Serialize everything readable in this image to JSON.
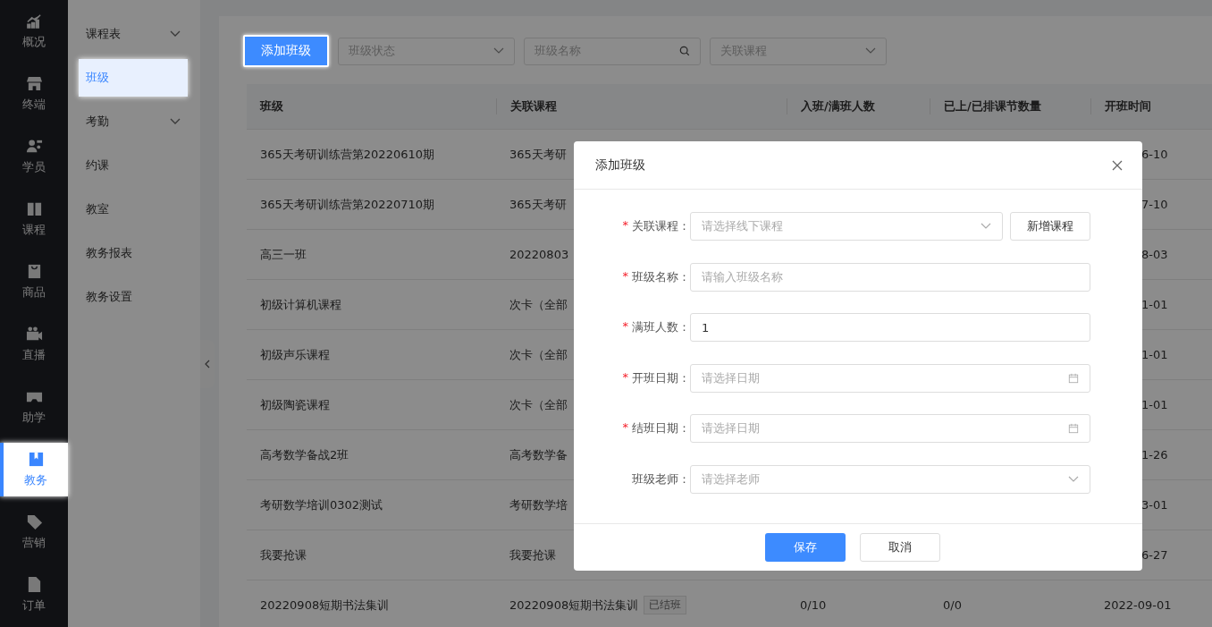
{
  "nav": [
    {
      "label": "概况",
      "selected": false
    },
    {
      "label": "终端",
      "selected": false
    },
    {
      "label": "学员",
      "selected": false
    },
    {
      "label": "课程",
      "selected": false
    },
    {
      "label": "商品",
      "selected": false
    },
    {
      "label": "直播",
      "selected": false
    },
    {
      "label": "助学",
      "selected": false
    },
    {
      "label": "教务",
      "selected": true
    },
    {
      "label": "营销",
      "selected": false
    },
    {
      "label": "订单",
      "selected": false
    }
  ],
  "submenu": [
    {
      "label": "课程表",
      "expandable": true,
      "selected": false
    },
    {
      "label": "班级",
      "expandable": false,
      "selected": true
    },
    {
      "label": "考勤",
      "expandable": true,
      "selected": false
    },
    {
      "label": "约课",
      "expandable": false,
      "selected": false
    },
    {
      "label": "教室",
      "expandable": false,
      "selected": false
    },
    {
      "label": "教务报表",
      "expandable": false,
      "selected": false
    },
    {
      "label": "教务设置",
      "expandable": false,
      "selected": false
    }
  ],
  "toolbar": {
    "add_button": "添加班级",
    "filters": [
      {
        "kind": "select",
        "placeholder": "班级状态"
      },
      {
        "kind": "search",
        "placeholder": "班级名称"
      },
      {
        "kind": "select",
        "placeholder": "关联课程"
      }
    ]
  },
  "table": {
    "columns": [
      "班级",
      "关联课程",
      "入班/满班人数",
      "已上/已排课节数量",
      "开班时间"
    ],
    "rows": [
      {
        "class_name": "365天考研训练营第20220610期",
        "course": "365天考研",
        "start_date": "6-10"
      },
      {
        "class_name": "365天考研训练营第20220710期",
        "course": "365天考研",
        "start_date": "7-10"
      },
      {
        "class_name": "高三一班",
        "course": "20220803",
        "start_date": "8-03"
      },
      {
        "class_name": "初级计算机课程",
        "course": "次卡（全部",
        "start_date": "1-01"
      },
      {
        "class_name": "初级声乐课程",
        "course": "次卡（全部",
        "start_date": "1-01"
      },
      {
        "class_name": "初级陶瓷课程",
        "course": "次卡（全部",
        "start_date": "1-01"
      },
      {
        "class_name": "高考数学备战2班",
        "course": "高考数学备",
        "start_date": "1-26"
      },
      {
        "class_name": "考研数学培训0302测试",
        "course": "考研数学培",
        "start_date": "3-01"
      },
      {
        "class_name": "我要抢课",
        "course": "我要抢课",
        "start_date": "6-27"
      },
      {
        "class_name": "20220908短期书法集训",
        "course": "20220908短期书法集训",
        "course_tag": "已结班",
        "enrolled": "0/10",
        "lessons": "0/0",
        "start_date": "2022-09-01"
      }
    ]
  },
  "modal": {
    "title": "添加班级",
    "fields": [
      {
        "label": "关联课程：",
        "required_mark": "*",
        "kind": "select",
        "placeholder": "请选择线下课程",
        "extra_button": "新增课程"
      },
      {
        "label": "班级名称：",
        "required_mark": "*",
        "kind": "input",
        "placeholder": "请输入班级名称"
      },
      {
        "label": "满班人数：",
        "required_mark": "*",
        "kind": "input",
        "value": "1"
      },
      {
        "label": "开班日期：",
        "required_mark": "*",
        "kind": "date",
        "placeholder": "请选择日期"
      },
      {
        "label": "结班日期：",
        "required_mark": "*",
        "kind": "date",
        "placeholder": "请选择日期"
      },
      {
        "label": "班级老师：",
        "kind": "select",
        "placeholder": "请选择老师"
      }
    ],
    "save_button": "保存",
    "cancel_button": "取消"
  }
}
